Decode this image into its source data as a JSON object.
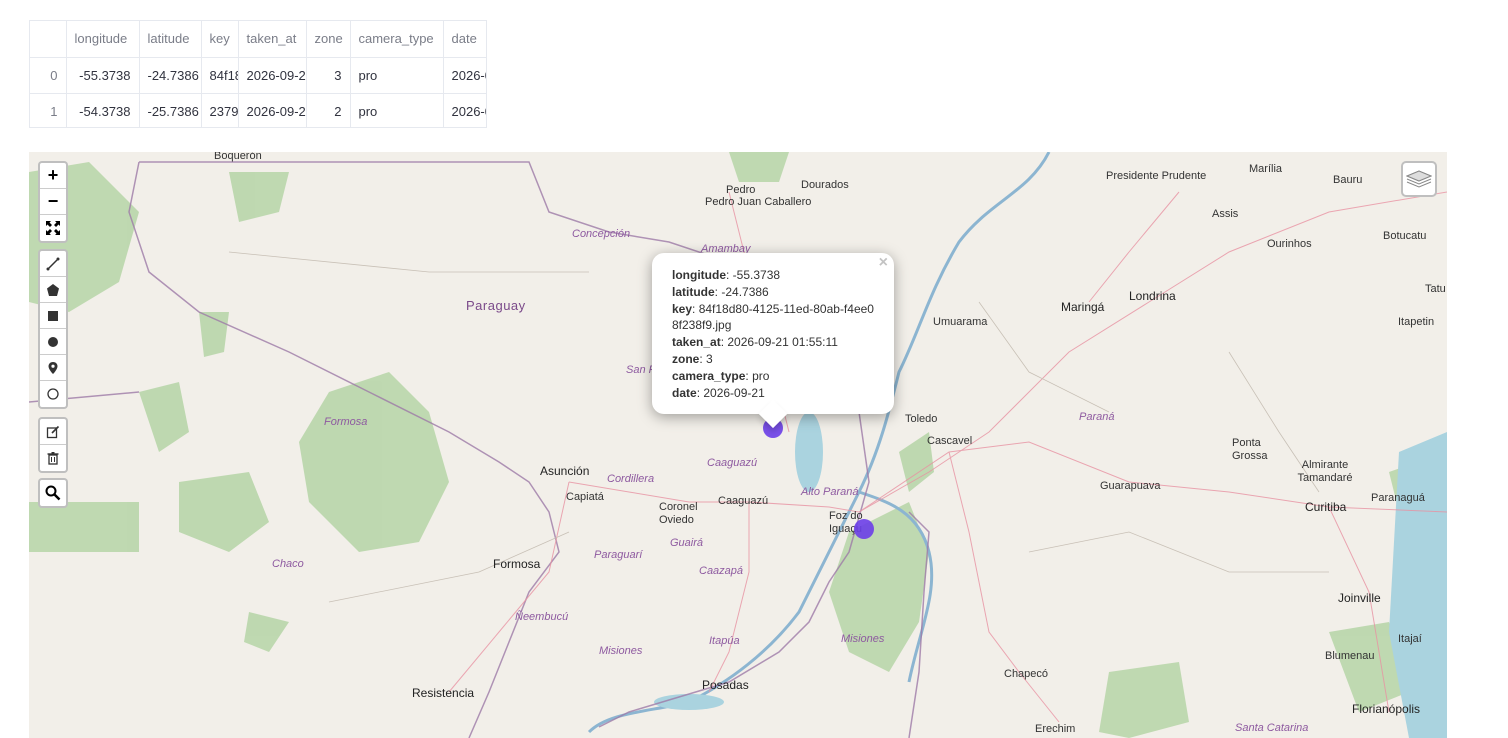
{
  "table": {
    "columns": [
      "",
      "longitude",
      "latitude",
      "key",
      "taken_at",
      "zone",
      "camera_type",
      "date"
    ],
    "rows": [
      {
        "index": "0",
        "longitude": "-55.3738",
        "latitude": "-24.7386",
        "key": "84f18",
        "taken_at": "2026-09-2",
        "zone": "3",
        "camera_type": "pro",
        "date": "2026-0"
      },
      {
        "index": "1",
        "longitude": "-54.3738",
        "latitude": "-25.7386",
        "key": "2379",
        "taken_at": "2026-09-2",
        "zone": "2",
        "camera_type": "pro",
        "date": "2026-0"
      }
    ]
  },
  "map": {
    "controls": {
      "zoom_in": "+",
      "zoom_out": "−"
    },
    "countries": [
      "Paraguay"
    ],
    "cities": [
      "Boquerón",
      "Pedro Juan Caballero",
      "Dourados",
      "Presidente Prudente",
      "Marília",
      "Bauru",
      "Assis",
      "Ourinhos",
      "Botucatu",
      "Tatu",
      "Maringá",
      "Londrina",
      "Itapetin",
      "Umuarama",
      "Toledo",
      "Cascavel",
      "Asunción",
      "Capiatá",
      "Coronel Oviedo",
      "Caaguazú",
      "Foz do Iguaçu",
      "Formosa",
      "Guarapuava",
      "Ponta Grossa",
      "Almirante Tamandaré",
      "Curitiba",
      "Paranaguá",
      "Joinville",
      "Itajaí",
      "Blumenau",
      "Posadas",
      "Resistencia",
      "Chapecó",
      "Erechim",
      "Florianópolis"
    ],
    "regions": [
      "Concepción",
      "Amambay",
      "San Pe",
      "Formosa",
      "Cordillera",
      "Caaguazú",
      "Alto Paraná",
      "Guairá",
      "Paraguarí",
      "Caazapá",
      "Chaco",
      "Ñeembucú",
      "Itapúa",
      "Misiones",
      "Misiones",
      "Paraná",
      "Santa Catarina"
    ],
    "popup": {
      "close": "×",
      "fields": [
        {
          "label": "longitude",
          "value": "-55.3738"
        },
        {
          "label": "latitude",
          "value": "-24.7386"
        },
        {
          "label": "key",
          "value": "84f18d80-4125-11ed-80ab-f4ee08f238f9.jpg"
        },
        {
          "label": "taken_at",
          "value": "2026-09-21 01:55:11"
        },
        {
          "label": "zone",
          "value": "3"
        },
        {
          "label": "camera_type",
          "value": "pro"
        },
        {
          "label": "date",
          "value": "2026-09-21"
        }
      ]
    },
    "colors": {
      "land": "#f2efe9",
      "forest": "#add19e",
      "water": "#aad3df",
      "marker": "#6b3ee8",
      "border": "#9e7ba8",
      "road": "#e892a2"
    }
  }
}
